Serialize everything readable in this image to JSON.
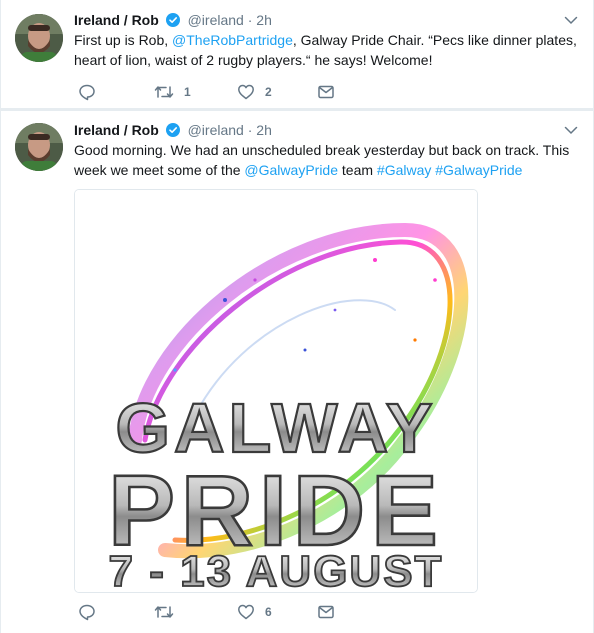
{
  "tweets": [
    {
      "name": "Ireland / Rob",
      "handle": "@ireland",
      "separator": "·",
      "time": "2h",
      "text_parts": {
        "a": "First up is Rob, ",
        "mention": "@TheRobPartridge",
        "b": ", Galway Pride Chair. “Pecs like dinner plates, heart of lion, waist of 2 rugby players.“ he says! Welcome!"
      },
      "actions": {
        "reply": "",
        "retweet": "1",
        "like": "2"
      }
    },
    {
      "name": "Ireland / Rob",
      "handle": "@ireland",
      "separator": "·",
      "time": "2h",
      "text_parts": {
        "a": "Good morning. We had an unscheduled break yesterday but back on track. This week we meet some of the ",
        "mention": "@GalwayPride",
        "b": " team ",
        "hashtag1": "#Galway",
        "space": " ",
        "hashtag2": "#GalwayPride"
      },
      "media": {
        "line1": "GALWAY",
        "line2": "PRIDE",
        "line3": "7 - 13 AUGUST"
      },
      "actions": {
        "reply": "",
        "retweet": "",
        "like": "6"
      }
    }
  ],
  "colors": {
    "link": "#1da1f2",
    "muted": "#657786",
    "verified": "#1da1f2",
    "separator": "#e6ecf0"
  },
  "icons": [
    "avatar",
    "verified-badge-icon",
    "chevron-down-icon",
    "reply-icon",
    "retweet-icon",
    "like-icon",
    "direct-message-icon"
  ]
}
